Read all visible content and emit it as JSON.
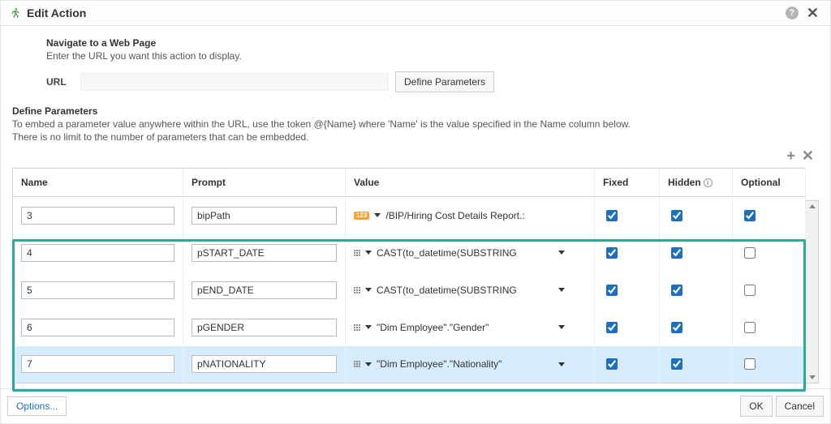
{
  "dialog": {
    "title": "Edit Action",
    "nav_title": "Navigate to a Web Page",
    "nav_sub": "Enter the URL you want this action to display.",
    "url_label": "URL",
    "url_value": "",
    "define_btn": "Define Parameters",
    "def_params_title": "Define Parameters",
    "def_params_text1": "To embed a parameter value anywhere within the URL, use the token @{Name} where 'Name' is the value specified in the Name column below.",
    "def_params_text2": "There is no limit to the number of parameters that can be embedded."
  },
  "table": {
    "headers": {
      "name": "Name",
      "prompt": "Prompt",
      "value": "Value",
      "fixed": "Fixed",
      "hidden": "Hidden",
      "optional": "Optional"
    },
    "rows": [
      {
        "name": "3",
        "prompt": "bipPath",
        "value_kind": "text",
        "value": "/BIP/Hiring Cost Details Report.:",
        "fixed": true,
        "hidden": true,
        "optional": true,
        "selected": false
      },
      {
        "name": "4",
        "prompt": "pSTART_DATE",
        "value_kind": "expr",
        "value": "CAST(to_datetime(SUBSTRING",
        "fixed": true,
        "hidden": true,
        "optional": false,
        "selected": false
      },
      {
        "name": "5",
        "prompt": "pEND_DATE",
        "value_kind": "expr",
        "value": "CAST(to_datetime(SUBSTRING",
        "fixed": true,
        "hidden": true,
        "optional": false,
        "selected": false
      },
      {
        "name": "6",
        "prompt": "pGENDER",
        "value_kind": "expr",
        "value": "\"Dim Employee\".\"Gender\"",
        "fixed": true,
        "hidden": true,
        "optional": false,
        "selected": false
      },
      {
        "name": "7",
        "prompt": "pNATIONALITY",
        "value_kind": "expr",
        "value": "\"Dim Employee\".\"Nationality\"",
        "fixed": true,
        "hidden": true,
        "optional": false,
        "selected": true
      }
    ]
  },
  "footer": {
    "options": "Options...",
    "ok": "OK",
    "cancel": "Cancel"
  },
  "icons": {
    "badge": "123"
  }
}
